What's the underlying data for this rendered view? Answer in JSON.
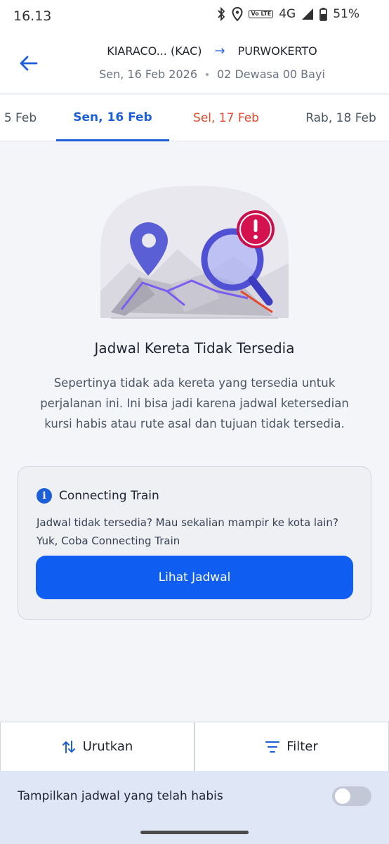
{
  "status_bar": {
    "time": "16.13",
    "network": "4G",
    "volte": "Vo LTE",
    "battery": "51%",
    "icons": [
      "bluetooth-icon",
      "location-icon",
      "volte-icon",
      "signal-icon",
      "battery-icon"
    ]
  },
  "header": {
    "origin": "KIARACO... (KAC)",
    "destination": "PURWOKERTO",
    "date": "Sen, 16 Feb 2026",
    "passengers": "02 Dewasa 00 Bayi"
  },
  "date_tabs": [
    {
      "label": "5 Feb",
      "state": "normal"
    },
    {
      "label": "Sen, 16 Feb",
      "state": "active"
    },
    {
      "label": "Sel, 17 Feb",
      "state": "holiday"
    },
    {
      "label": "Rab, 18 Feb",
      "state": "normal"
    }
  ],
  "empty_state": {
    "title": "Jadwal Kereta Tidak Tersedia",
    "description": "Sepertinya tidak ada kereta yang tersedia untuk perjalanan ini. Ini bisa jadi karena jadwal ketersedian kursi habis atau rute asal dan tujuan tidak tersedia."
  },
  "connecting_card": {
    "title": "Connecting Train",
    "description": "Jadwal tidak tersedia? Mau sekalian mampir ke kota lain? Yuk, Coba Connecting Train",
    "button_label": "Lihat Jadwal"
  },
  "bottom_bar": {
    "sort_label": "Urutkan",
    "filter_label": "Filter"
  },
  "toggle_row": {
    "label": "Tampilkan jadwal yang telah habis",
    "enabled": false
  },
  "colors": {
    "accent": "#1d5fd6",
    "button": "#0f5ef1",
    "holiday": "#e2492f",
    "background": "#f4f5f9"
  }
}
